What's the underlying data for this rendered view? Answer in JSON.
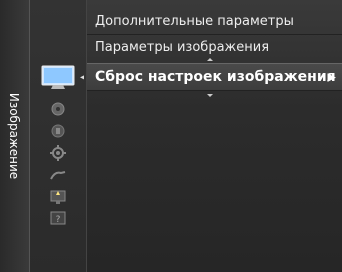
{
  "side_tab": {
    "label": "Изображение"
  },
  "menu": {
    "items": [
      {
        "label": "Дополнительные параметры"
      },
      {
        "label": "Параметры изображения"
      },
      {
        "label": "Сброс настроек изображения"
      }
    ]
  },
  "icons": [
    "picture-tv-icon",
    "sound-icon",
    "channel-icon",
    "setup-gear-icon",
    "input-icon",
    "application-icon",
    "support-icon"
  ],
  "colors": {
    "background": "#2c2c2c",
    "highlight": "#444444",
    "text": "#ffffff"
  }
}
